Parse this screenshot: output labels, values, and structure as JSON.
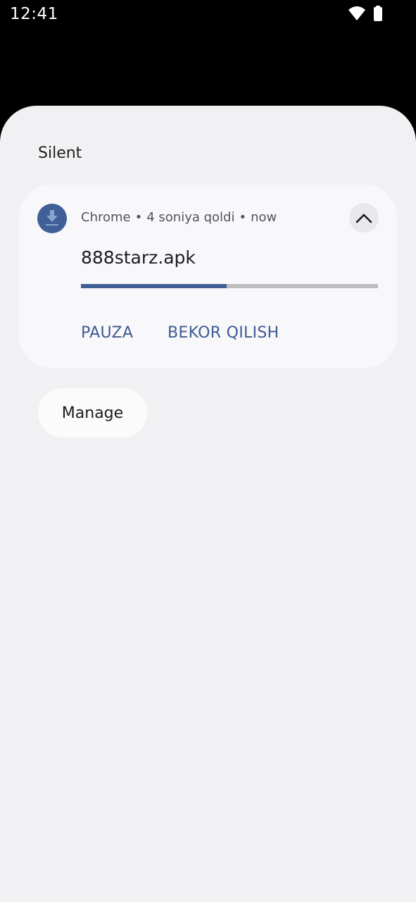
{
  "status_bar": {
    "time": "12:41",
    "wifi_icon": "wifi-icon",
    "battery_icon": "battery-icon"
  },
  "section": {
    "title": "Silent"
  },
  "notification": {
    "app_icon": "download-icon",
    "app_name": "Chrome",
    "separator": "•",
    "subtext": "4 soniya qoldi",
    "time": "now",
    "expand_icon": "chevron-up-icon",
    "title": "888starz.apk",
    "progress": 0.49,
    "colors": {
      "accent": "#3f5f96",
      "track": "#bdbdc0"
    },
    "actions": {
      "pause": "PAUZA",
      "cancel": "BEKOR QILISH"
    }
  },
  "manage_label": "Manage"
}
